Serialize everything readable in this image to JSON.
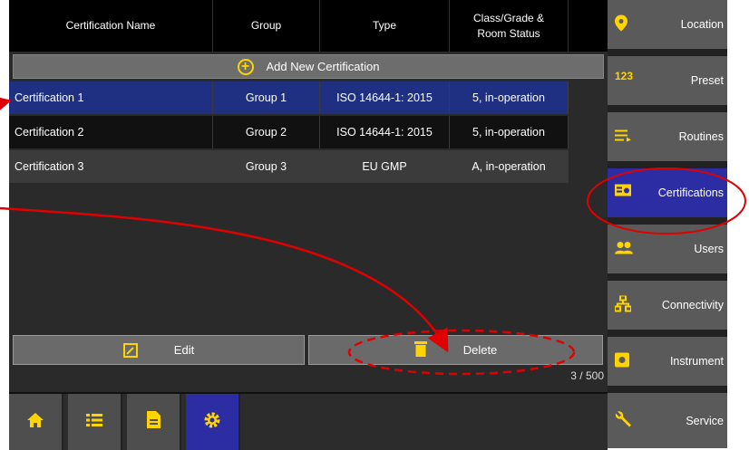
{
  "table": {
    "headers": [
      "Certification Name",
      "Group",
      "Type",
      "Class/Grade &\nRoom Status"
    ],
    "add_label": "Add New Certification",
    "rows": [
      {
        "name": "Certification 1",
        "group": "Group 1",
        "type": "ISO 14644-1: 2015",
        "status": "5, in-operation"
      },
      {
        "name": "Certification 2",
        "group": "Group 2",
        "type": "ISO 14644-1: 2015",
        "status": "5, in-operation"
      },
      {
        "name": "Certification 3",
        "group": "Group 3",
        "type": "EU GMP",
        "status": "A, in-operation"
      }
    ]
  },
  "actions": {
    "edit_label": "Edit",
    "delete_label": "Delete"
  },
  "counter": "3 / 500",
  "bottom_nav": [
    "home-icon",
    "list-icon",
    "document-icon",
    "gear-icon"
  ],
  "sidebar": [
    {
      "label": "Location",
      "icon": "location-pin-icon"
    },
    {
      "label": "Preset",
      "icon": "123-icon"
    },
    {
      "label": "Routines",
      "icon": "routines-icon"
    },
    {
      "label": "Certifications",
      "icon": "certificate-icon",
      "active": true
    },
    {
      "label": "Users",
      "icon": "users-icon"
    },
    {
      "label": "Connectivity",
      "icon": "network-icon"
    },
    {
      "label": "Instrument",
      "icon": "instrument-icon"
    },
    {
      "label": "Service",
      "icon": "wrench-icon"
    }
  ],
  "colors": {
    "accent_yellow": "#ffd400",
    "selected_blue": "#1f2f82",
    "active_blue": "#2d2da3",
    "annotation_red": "#e00000"
  }
}
